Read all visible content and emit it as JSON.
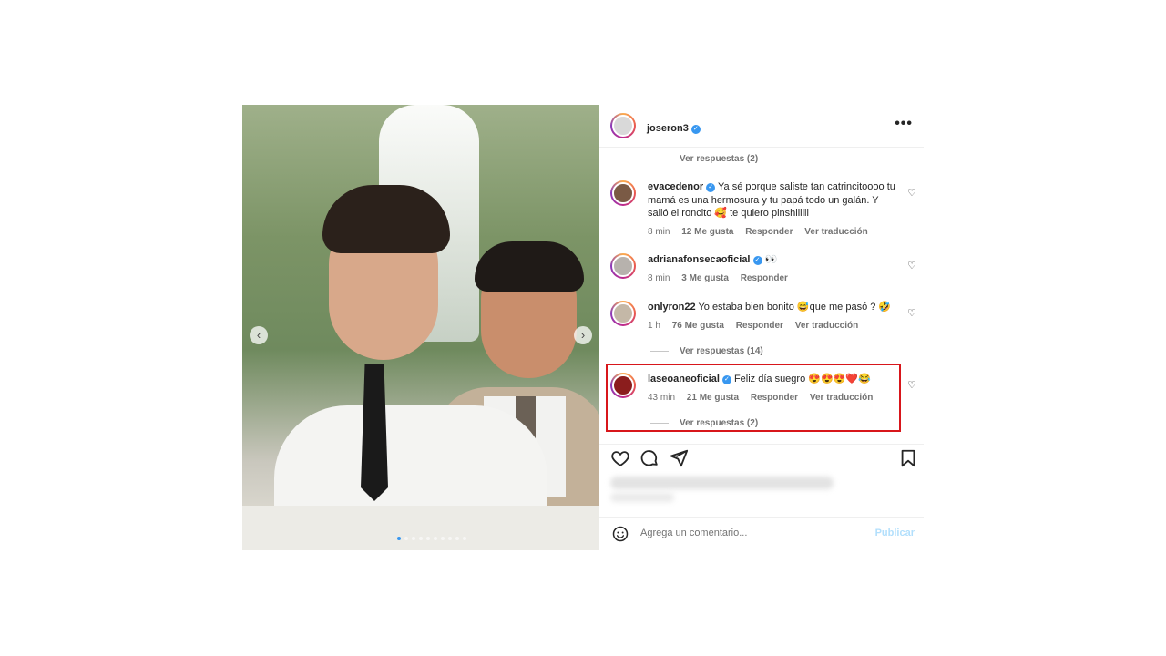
{
  "post": {
    "username": "joseron3",
    "verified": true,
    "more_icon": "more-horizontal-icon",
    "media": {
      "current_slide": 1,
      "total_slides": 10
    }
  },
  "comments": [
    {
      "type": "replies",
      "label": "Ver respuestas (2)"
    },
    {
      "type": "comment",
      "username": "evacedenor",
      "verified": true,
      "text": "Ya sé porque saliste tan catrincitoooo tu mamá es una hermosura y tu papá todo un galán. Y salió el roncito 🥰 te quiero pinshiiiiii",
      "time": "8 min",
      "likes": "12 Me gusta",
      "reply": "Responder",
      "translate": "Ver traducción"
    },
    {
      "type": "comment",
      "username": "adrianafonsecaoficial",
      "verified": true,
      "text": "👀",
      "time": "8 min",
      "likes": "3 Me gusta",
      "reply": "Responder"
    },
    {
      "type": "comment",
      "username": "onlyron22",
      "verified": false,
      "text": "Yo estaba bien bonito 😅que me pasó ? 🤣",
      "time": "1 h",
      "likes": "76 Me gusta",
      "reply": "Responder",
      "translate": "Ver traducción"
    },
    {
      "type": "replies",
      "label": "Ver respuestas (14)"
    },
    {
      "type": "comment",
      "username": "laseoaneoficial",
      "verified": true,
      "highlighted": true,
      "text": "Feliz día suegro 😍😍😍❤️😂",
      "time": "43 min",
      "likes": "21 Me gusta",
      "reply": "Responder",
      "translate": "Ver traducción"
    },
    {
      "type": "replies",
      "label": "Ver respuestas (2)"
    }
  ],
  "actions": [
    "heart-icon",
    "comment-icon",
    "share-icon",
    "bookmark-icon"
  ],
  "add_comment": {
    "placeholder": "Agrega un comentario...",
    "publish": "Publicar",
    "emoji_icon": "emoji-icon"
  },
  "colors": {
    "highlight": "#d8161b",
    "verified": "#3897f0",
    "publish": "#b2dffc"
  }
}
